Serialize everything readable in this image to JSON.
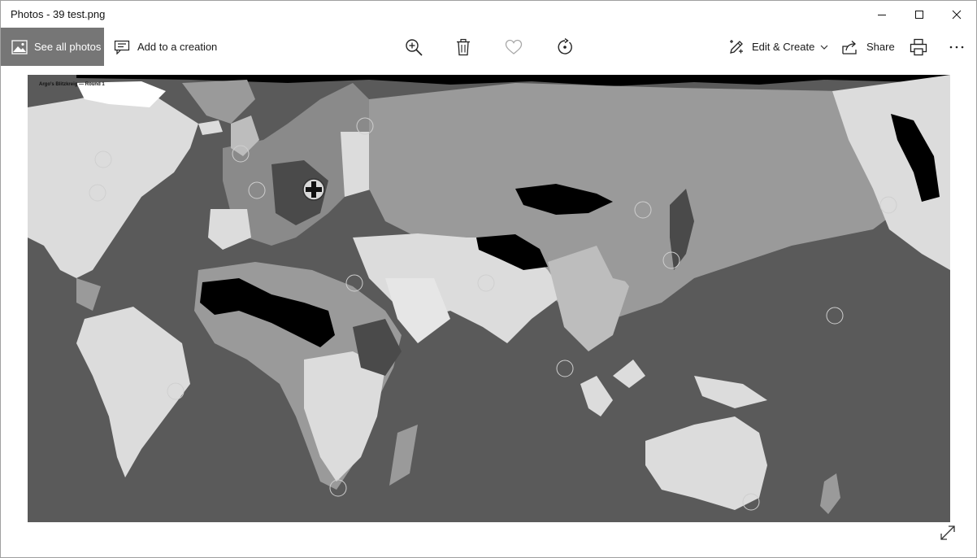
{
  "window": {
    "title": "Photos - 39 test.png"
  },
  "toolbar": {
    "see_all_label": "See all photos",
    "add_creation_label": "Add to a creation",
    "edit_create_label": "Edit & Create",
    "share_label": "Share"
  },
  "icons": {
    "minimize": "minimize-icon",
    "maximize": "maximize-icon",
    "close": "close-icon",
    "photos": "photos-icon",
    "creation": "creation-icon",
    "zoom": "zoom-in-icon",
    "delete": "trash-icon",
    "favorite": "heart-icon",
    "rotate": "rotate-icon",
    "edit": "edit-pencil-icon",
    "chevron": "chevron-down-icon",
    "share": "share-icon",
    "print": "printer-icon",
    "more": "more-icon",
    "expand": "expand-icon"
  },
  "image": {
    "caption": "Argo's Blitzkreig — Round 1"
  },
  "colors": {
    "accent_gray": "#767676",
    "ocean": "#5a5a5a",
    "land_light": "#dcdcdc",
    "land_mid": "#9a9a9a",
    "land_dark": "#4a4a4a",
    "black_region": "#000000"
  }
}
